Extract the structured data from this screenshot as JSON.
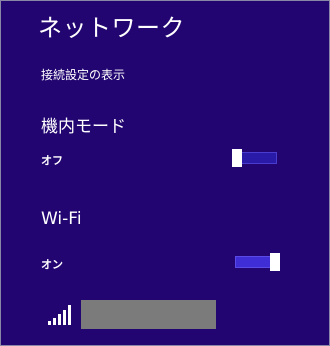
{
  "panel": {
    "title": "ネットワーク",
    "show_connection_settings": "接続設定の表示"
  },
  "airplane_mode": {
    "label": "機内モード",
    "state_label": "オフ",
    "enabled": false
  },
  "wifi": {
    "label": "Wi-Fi",
    "state_label": "オン",
    "enabled": true
  },
  "networks": [
    {
      "name": "",
      "name_redacted": true,
      "signal_bars": 5,
      "signal_icon": "wifi-signal-icon"
    }
  ],
  "colors": {
    "background": "#220570",
    "toggle_track": "#2a1aa8",
    "toggle_thumb": "#ffffff",
    "redaction": "#7b7b7b"
  }
}
